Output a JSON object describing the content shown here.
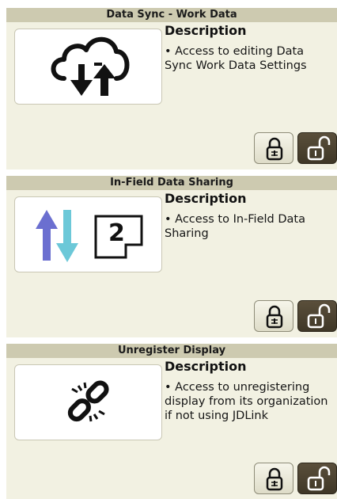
{
  "panels": [
    {
      "title": "Data Sync - Work Data",
      "description_heading": "Description",
      "description": "• Access to editing Data Sync Work Data Settings",
      "icon": "cloud-sync-icon",
      "lock_state": "unlocked"
    },
    {
      "title": "In-Field Data Sharing",
      "description_heading": "Description",
      "description": "• Access to In-Field Data Sharing",
      "icon": "data-sharing-icon",
      "icon_number": "2",
      "lock_state": "unlocked"
    },
    {
      "title": "Unregister Display",
      "description_heading": "Description",
      "description": "• Access to unregistering display from its organization if not using JDLink",
      "icon": "broken-link-icon",
      "lock_state": "unlocked"
    }
  ],
  "colors": {
    "panel_bg": "#f2f1e2",
    "header_bg": "#cdcab0",
    "lock_button": "#e8e6d4",
    "unlock_button_selected": "#4a4130",
    "arrow_up": "#6b6fd0",
    "arrow_down": "#6cc8d8"
  }
}
